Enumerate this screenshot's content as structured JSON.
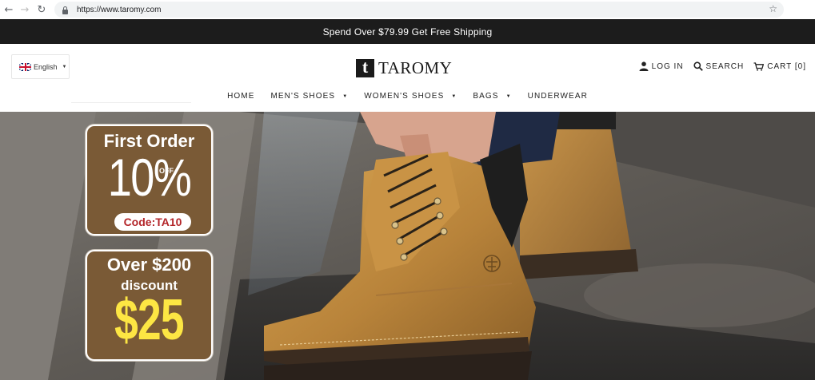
{
  "browser": {
    "url": "https://www.taromy.com",
    "back_icon": "←",
    "forward_icon": "→",
    "reload_icon": "↻",
    "star_icon": "☆"
  },
  "announcement": {
    "text": "Spend Over $79.99 Get Free Shipping"
  },
  "header": {
    "language": "English",
    "logo_letter": "t",
    "logo_text": "TAROMY",
    "login_label": "LOG IN",
    "search_label": "SEARCH",
    "cart_label": "CART [0]"
  },
  "nav": {
    "items": [
      {
        "label": "HOME",
        "dropdown": false
      },
      {
        "label": "MEN'S SHOES",
        "dropdown": true
      },
      {
        "label": "WOMEN'S SHOES",
        "dropdown": true
      },
      {
        "label": "BAGS",
        "dropdown": true
      },
      {
        "label": "UNDERWEAR",
        "dropdown": false
      }
    ]
  },
  "promos": {
    "first_order": {
      "title": "First Order",
      "percent": "10%",
      "off": "OFF",
      "code": "Code:TA10"
    },
    "over_200": {
      "title": "Over $200",
      "subtitle": "discount",
      "amount": "$25"
    }
  },
  "colors": {
    "announcement_bg": "#1c1c1c",
    "promo_brown": "#7a5a36",
    "promo_yellow": "#fde643",
    "code_red": "#b3262a"
  }
}
